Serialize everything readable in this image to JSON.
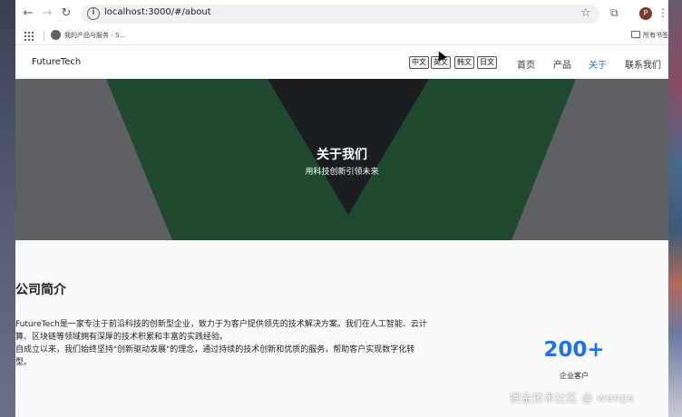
{
  "browser": {
    "url": "localhost:3000/#/about",
    "profile_initial": "P",
    "bookmark_label": "我的产品与服务 - S...",
    "all_bookmarks_label": "所有书签"
  },
  "site": {
    "logo": "FutureTech",
    "languages": [
      "中文",
      "英文",
      "韩文",
      "日文"
    ],
    "nav": [
      "首页",
      "产品",
      "关于",
      "联系我们"
    ],
    "active_nav": "关于"
  },
  "hero": {
    "title": "关于我们",
    "subtitle": "用科技创新引领未来"
  },
  "intro": {
    "title": "公司简介",
    "line1": "FutureTech是一家专注于前沿科技的创新型企业，致力于为客户提供领先的技术解决方案。我们在人工智能、云计算、区块链等领域拥有深厚的技术积累和丰富的实践经验。",
    "line2": "自成立以来，我们始终坚持\"创新驱动发展\"的理念，通过持续的技术创新和优质的服务，帮助客户实现数字化转型。"
  },
  "stat": {
    "value": "200+",
    "label": "企业客户"
  },
  "watermark": "掘金技术社区 @ wenps",
  "colors": {
    "accent": "#1a73e8",
    "hero_gray": "#5f6064",
    "hero_green": "#1f4a2f",
    "hero_dark": "#1a1e22"
  }
}
